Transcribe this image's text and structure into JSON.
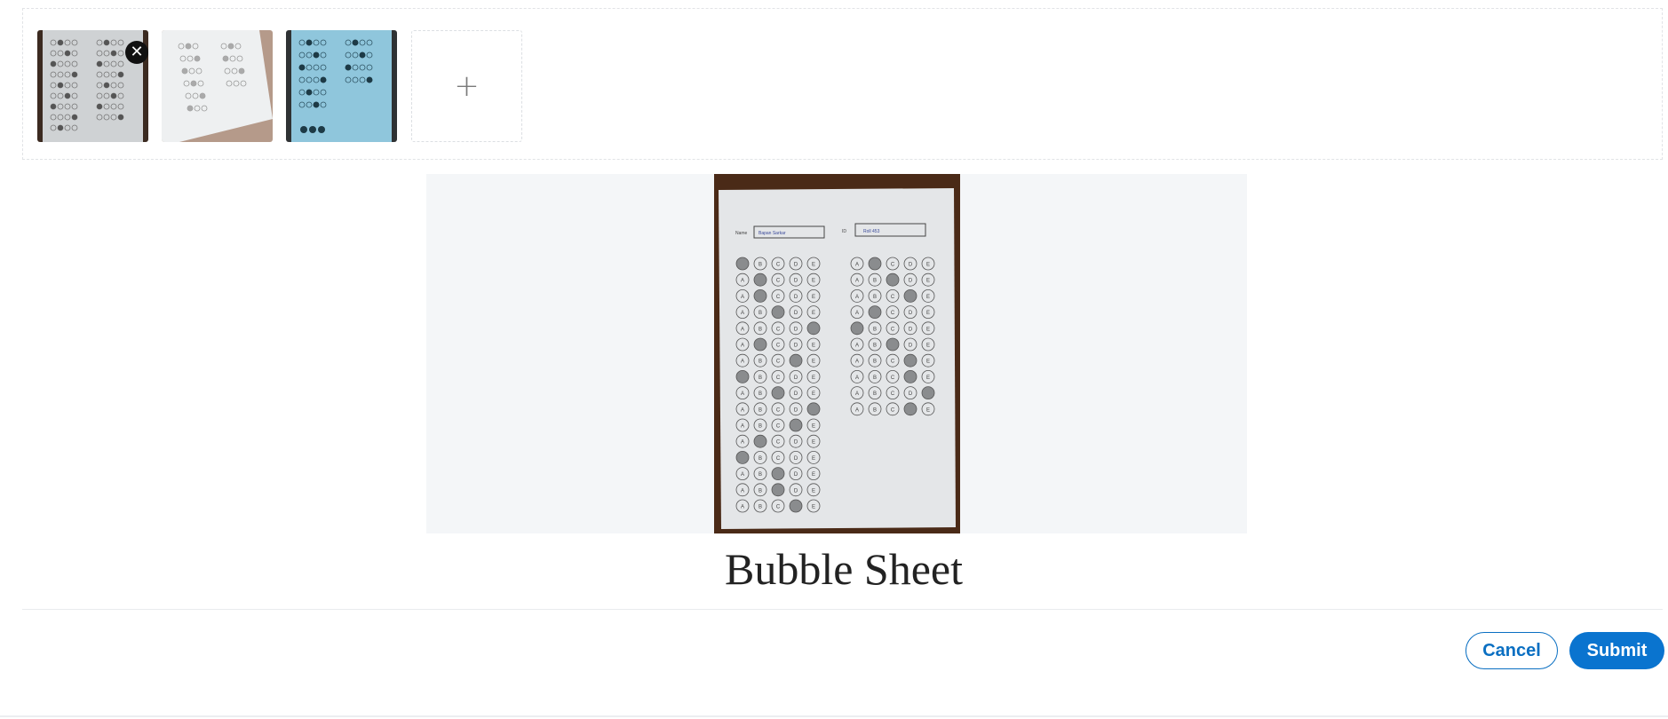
{
  "uploader": {
    "thumbnails": [
      {
        "name": "sheet-1",
        "selected": true
      },
      {
        "name": "sheet-2",
        "selected": false
      },
      {
        "name": "sheet-3",
        "selected": false
      }
    ],
    "remove_icon": "close-icon",
    "add_label": "+"
  },
  "preview": {
    "form": {
      "name_label": "Name",
      "name_value": "Bapan Sarkar",
      "id_label": "ID",
      "id_value": "Roll 453"
    },
    "options": [
      "A",
      "B",
      "C",
      "D",
      "E"
    ]
  },
  "caption": "Bubble Sheet",
  "actions": {
    "cancel_label": "Cancel",
    "submit_label": "Submit"
  },
  "colors": {
    "accent": "#0a74cf",
    "preview_bg": "#f4f6f8",
    "table_wood": "#4a2a17"
  }
}
